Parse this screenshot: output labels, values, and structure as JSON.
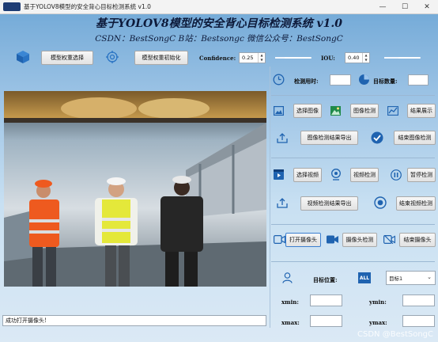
{
  "window": {
    "title": "基于YOLOV8模型的安全背心目标检测系统 v1.0",
    "minimize": "—",
    "maximize": "☐",
    "close": "✕"
  },
  "header": {
    "title": "基于YOLOV8模型的安全背心目标检测系统 v1.0",
    "subtitle": "CSDN：BestSongC   B站：Bestsongc   微信公众号：BestSongC"
  },
  "toolbar": {
    "model_select": "模型权重选择",
    "model_init": "模型权重初始化",
    "confidence_label": "Confidence:",
    "confidence_value": "0.25",
    "confidence_level": 0.25,
    "iou_label": "IOU:",
    "iou_value": "0.40",
    "iou_level": 0.4
  },
  "stats": {
    "time_label": "检测用时:",
    "time_value": "",
    "count_label": "目标数量:",
    "count_value": ""
  },
  "image_section": {
    "select": "选择图像",
    "detect": "图像检测",
    "show": "结果展示",
    "export": "图像检测结果导出",
    "stop": "结束图像检测"
  },
  "video_section": {
    "select": "选择视频",
    "detect": "视频检测",
    "pause": "暂停检测",
    "export": "视频检测结果导出",
    "stop": "结束视频检测"
  },
  "camera_section": {
    "open": "打开摄像头",
    "detect": "摄像头检测",
    "stop": "结束摄像头"
  },
  "target": {
    "position_label": "目标位置:",
    "all_label": "ALL",
    "selected": "目标1",
    "xmin_label": "xmin:",
    "ymin_label": "ymin:",
    "xmax_label": "xmax:",
    "ymax_label": "ymax:",
    "xmin": "",
    "ymin": "",
    "xmax": "",
    "ymax": ""
  },
  "status": {
    "message": "成功打开摄像头!"
  },
  "watermark": "CSDN @BestSongC"
}
